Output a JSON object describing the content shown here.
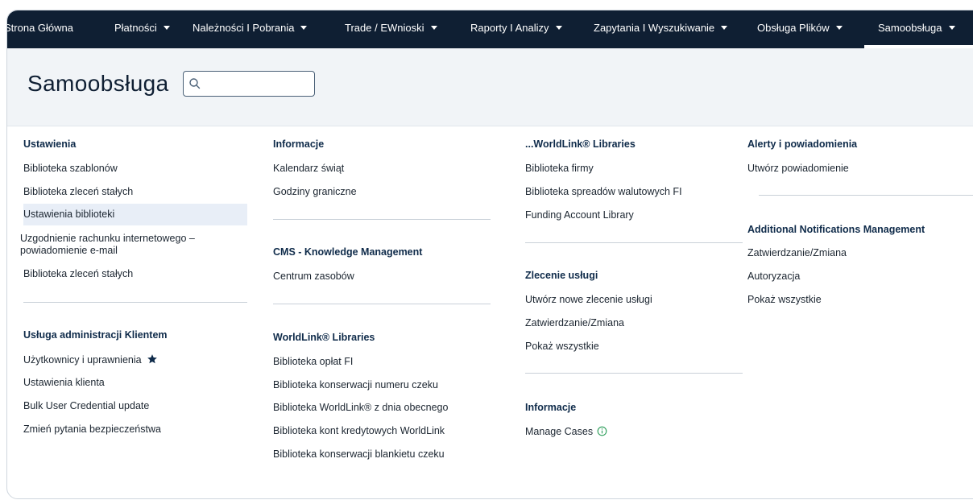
{
  "nav": {
    "items": [
      {
        "label": "Strona Główna",
        "caret": false
      },
      {
        "label": "Płatności",
        "caret": true
      },
      {
        "label": "Należności I Pobrania",
        "caret": true
      },
      {
        "label": "Trade / EWnioski",
        "caret": true
      },
      {
        "label": "Raporty I Analizy",
        "caret": true
      },
      {
        "label": "Zapytania I Wyszukiwanie",
        "caret": true
      },
      {
        "label": "Obsługa Plików",
        "caret": true
      },
      {
        "label": "Samoobsługa",
        "caret": true
      }
    ]
  },
  "header": {
    "title": "Samoobsługa",
    "search_placeholder": "",
    "search_value": ""
  },
  "columns": [
    {
      "sections": [
        {
          "heading": "Ustawienia",
          "items": [
            "Biblioteka szablonów",
            "Biblioteka zleceń stałych",
            "Ustawienia biblioteki",
            "Uzgodnienie rachunku internetowego – powiadomienie e-mail",
            "Biblioteka zleceń stałych"
          ]
        },
        {
          "heading": "Usługa administracji Klientem",
          "items": [
            "Użytkownicy i uprawnienia",
            "Ustawienia klienta",
            "Bulk User Credential update",
            "Zmień pytania bezpieczeństwa"
          ]
        }
      ]
    },
    {
      "sections": [
        {
          "heading": "Informacje",
          "items": [
            "Kalendarz świąt",
            "Godziny graniczne"
          ]
        },
        {
          "heading": "CMS - Knowledge Management",
          "items": [
            "Centrum zasobów"
          ]
        },
        {
          "heading": "WorldLink® Libraries",
          "items": [
            "Biblioteka opłat FI",
            "Biblioteka konserwacji numeru czeku",
            "Biblioteka WorldLink® z dnia obecnego",
            "Biblioteka kont kredytowych WorldLink",
            "Biblioteka konserwacji blankietu czeku"
          ]
        }
      ]
    },
    {
      "sections": [
        {
          "heading": "...WorldLink® Libraries",
          "items": [
            "Biblioteka firmy",
            "Biblioteka spreadów walutowych FI",
            "Funding Account Library"
          ]
        },
        {
          "heading": "Zlecenie usługi",
          "items": [
            "Utwórz nowe zlecenie usługi",
            "Zatwierdzanie/Zmiana",
            "Pokaż wszystkie"
          ]
        },
        {
          "heading": "Informacje",
          "items": [
            "Manage Cases"
          ]
        }
      ]
    },
    {
      "sections": [
        {
          "heading": "Alerty i powiadomienia",
          "items": [
            "Utwórz powiadomienie"
          ]
        },
        {
          "heading": "Additional Notifications Management",
          "items": [
            "Zatwierdzanie/Zmiana",
            "Autoryzacja",
            "Pokaż wszystkie"
          ]
        }
      ]
    }
  ],
  "icons": {
    "search": "search-icon",
    "favorite": "star-icon",
    "info": "info-icon",
    "dropdown": "chevron-down-icon"
  },
  "colors": {
    "nav_bg": "#0f1f33",
    "header_bg": "#f1f4f7",
    "highlight": "#e8eef7",
    "star": "#0f2b4a",
    "info": "#2e9e5b"
  }
}
